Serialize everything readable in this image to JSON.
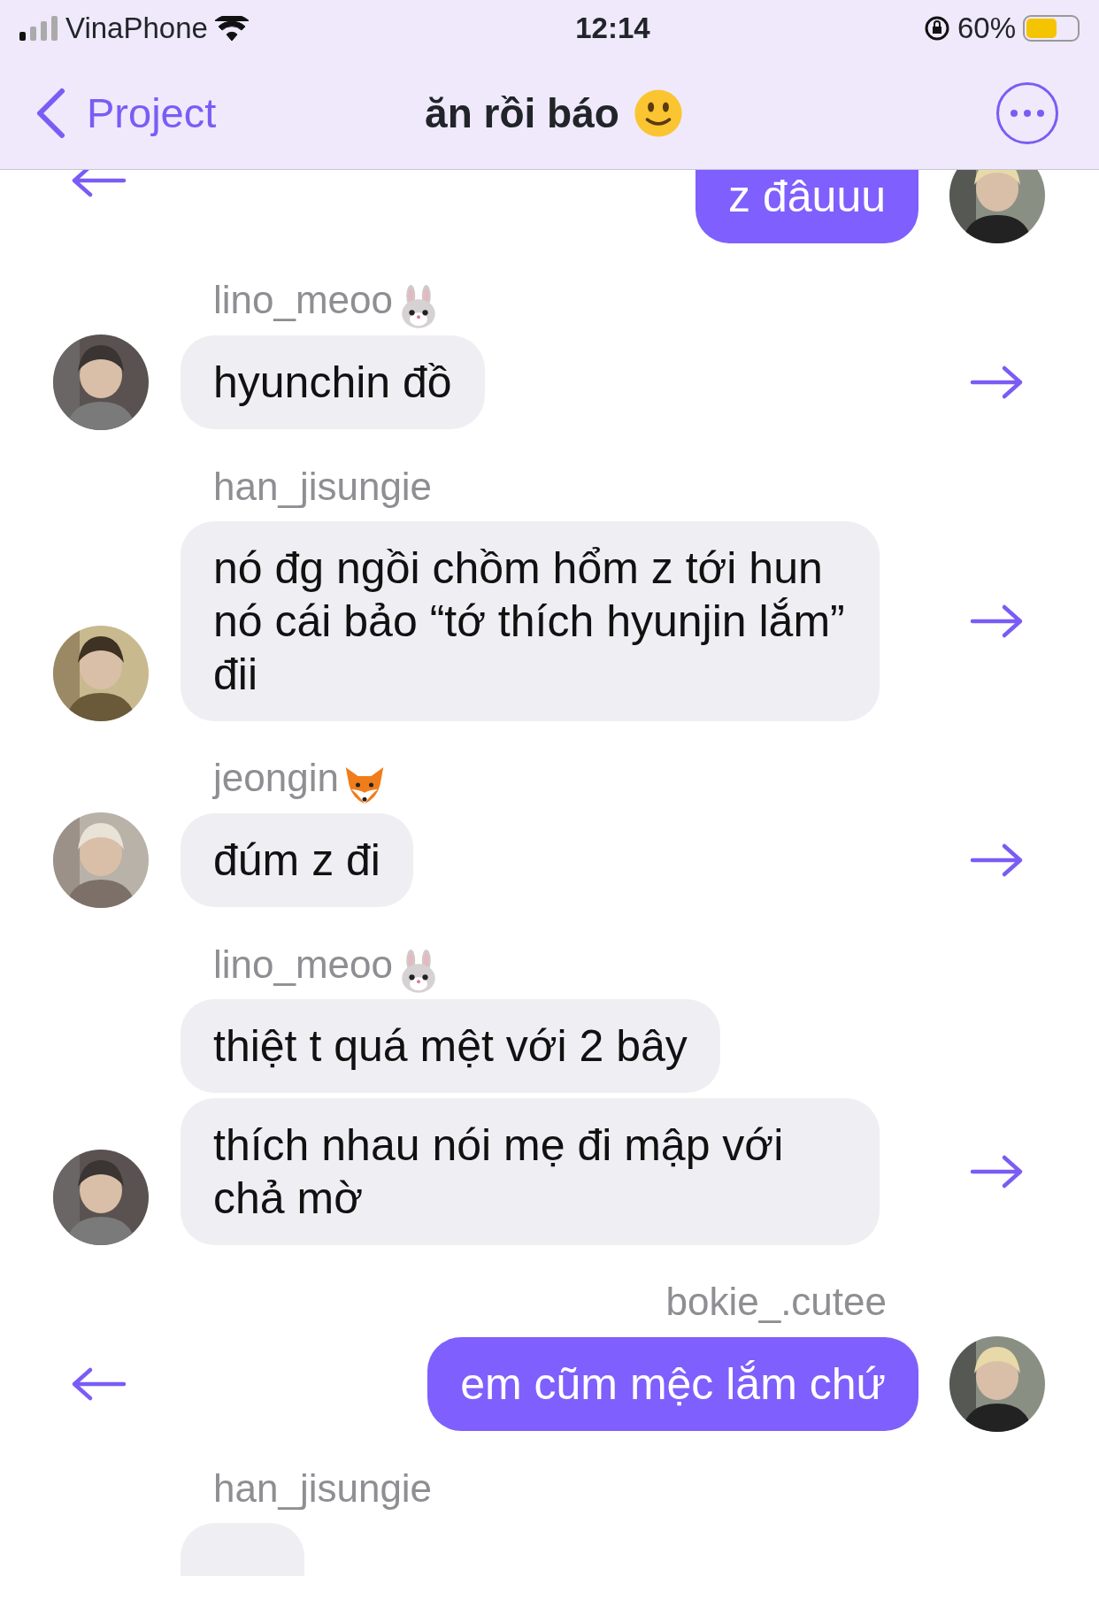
{
  "status_bar": {
    "carrier": "VinaPhone",
    "time": "12:14",
    "battery_text": "60%"
  },
  "header": {
    "back_label": "Project",
    "title": "ăn rồi báo",
    "title_icon": {
      "kind": "smiley"
    }
  },
  "groups": [
    {
      "kind": "outgoing",
      "bubbles": [
        "z đâuuu"
      ],
      "cut_top": true
    },
    {
      "kind": "incoming",
      "sender": "lino_meoo",
      "sender_icon": {
        "kind": "bunny"
      },
      "bubbles": [
        "hyunchin đồ"
      ]
    },
    {
      "kind": "incoming",
      "sender": "han_jisungie",
      "bubbles": [
        "nó đg ngồi chồm hổm z tới hun nó cái bảo “tớ thích hyunjin lắm” đii"
      ]
    },
    {
      "kind": "incoming",
      "sender": "jeongin",
      "sender_icon": {
        "kind": "fox"
      },
      "bubbles": [
        "đúm z đi"
      ]
    },
    {
      "kind": "incoming",
      "sender": "lino_meoo",
      "sender_icon": {
        "kind": "bunny"
      },
      "bubbles": [
        "thiệt t quá mệt với 2 bây",
        "thích nhau nói mẹ đi mập với chả mờ"
      ]
    },
    {
      "kind": "outgoing",
      "sender": "bokie_.cutee",
      "bubbles": [
        "em cũm mệc lắm chứ"
      ]
    },
    {
      "kind": "incoming",
      "sender": "han_jisungie",
      "cut_bottom": true
    }
  ]
}
